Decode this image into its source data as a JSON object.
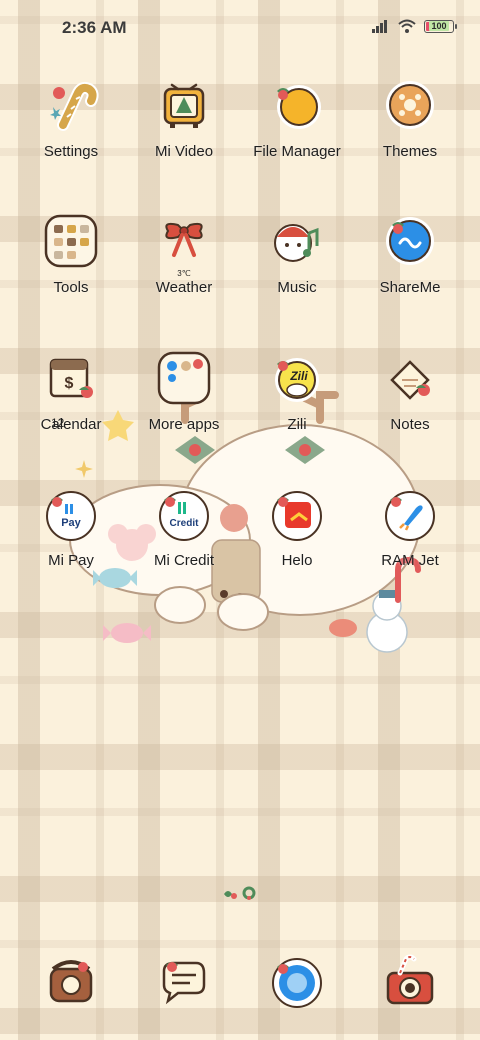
{
  "status_bar": {
    "time": "2:36 AM",
    "battery": "100"
  },
  "apps": [
    {
      "label": "Settings",
      "icon": "candy-cane-icon"
    },
    {
      "label": "Mi Video",
      "icon": "tv-icon"
    },
    {
      "label": "File Manager",
      "icon": "folder-icon"
    },
    {
      "label": "Themes",
      "icon": "palette-icon"
    },
    {
      "label": "Tools",
      "icon": "tools-folder-icon"
    },
    {
      "label": "Weather",
      "icon": "weather-bow-icon",
      "sub": "3℃"
    },
    {
      "label": "Music",
      "icon": "music-girl-icon"
    },
    {
      "label": "ShareMe",
      "icon": "shareme-icon"
    },
    {
      "label": "Calendar",
      "icon": "calendar-icon",
      "sub": "12"
    },
    {
      "label": "More apps",
      "icon": "more-apps-folder-icon"
    },
    {
      "label": "Zili",
      "icon": "zili-icon",
      "text": "Zili"
    },
    {
      "label": "Notes",
      "icon": "notes-icon"
    },
    {
      "label": "Mi Pay",
      "icon": "mi-pay-icon",
      "text": "Pay"
    },
    {
      "label": "Mi Credit",
      "icon": "mi-credit-icon",
      "text": "Credit"
    },
    {
      "label": "Helo",
      "icon": "helo-icon"
    },
    {
      "label": "RAM Jet",
      "icon": "rocket-icon"
    }
  ],
  "dock": [
    {
      "icon": "phone-icon"
    },
    {
      "icon": "messages-icon"
    },
    {
      "icon": "browser-icon"
    },
    {
      "icon": "camera-icon"
    }
  ]
}
